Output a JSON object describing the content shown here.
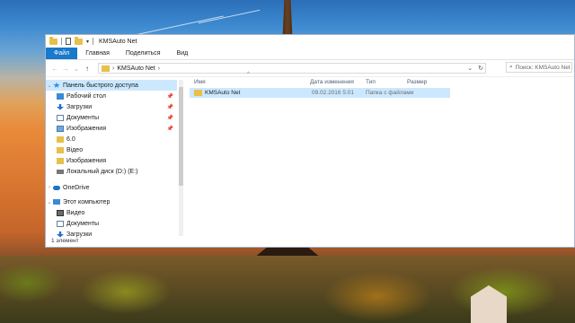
{
  "window": {
    "title": "KMSAuto Net",
    "ribbon_tabs": [
      "Файл",
      "Главная",
      "Поделиться",
      "Вид"
    ],
    "tab_labels": {
      "file": "Файл",
      "home": "Главная",
      "share": "Поделиться",
      "view": "Вид"
    }
  },
  "address": {
    "chevron": "›",
    "path": "KMSAuto Net",
    "dropdown_glyph": "⌄",
    "refresh_glyph": "↻"
  },
  "search": {
    "placeholder": "Поиск: KMSAuto Net",
    "icon": "search-icon"
  },
  "nav": {
    "quick_access": "Панель быстрого доступа",
    "items": [
      {
        "label": "Рабочий стол",
        "icon": "desktop-icon",
        "pinned": true
      },
      {
        "label": "Загрузки",
        "icon": "download-icon",
        "pinned": true
      },
      {
        "label": "Документы",
        "icon": "documents-icon",
        "pinned": true
      },
      {
        "label": "Изображения",
        "icon": "pictures-icon",
        "pinned": true
      },
      {
        "label": "6.0",
        "icon": "folder-icon",
        "pinned": false
      },
      {
        "label": "Відео",
        "icon": "folder-icon",
        "pinned": false
      },
      {
        "label": "Изображения",
        "icon": "folder-icon",
        "pinned": false
      },
      {
        "label": "Локальный диск (D:) (E:)",
        "icon": "disk-icon",
        "pinned": false
      }
    ],
    "onedrive": "OneDrive",
    "this_pc": "Этот компьютер",
    "pc_items": [
      {
        "label": "Видео",
        "icon": "video-icon"
      },
      {
        "label": "Документы",
        "icon": "documents-icon"
      },
      {
        "label": "Загрузки",
        "icon": "download-icon"
      }
    ]
  },
  "columns": {
    "name": "Имя",
    "date": "Дата изменения",
    "type": "Тип",
    "size": "Размер"
  },
  "files": [
    {
      "name": "KMSAuto Net",
      "date": "09.02.2016 5:01",
      "type": "Папка с файлами",
      "size": ""
    }
  ],
  "status": {
    "count": "1 элемент"
  }
}
